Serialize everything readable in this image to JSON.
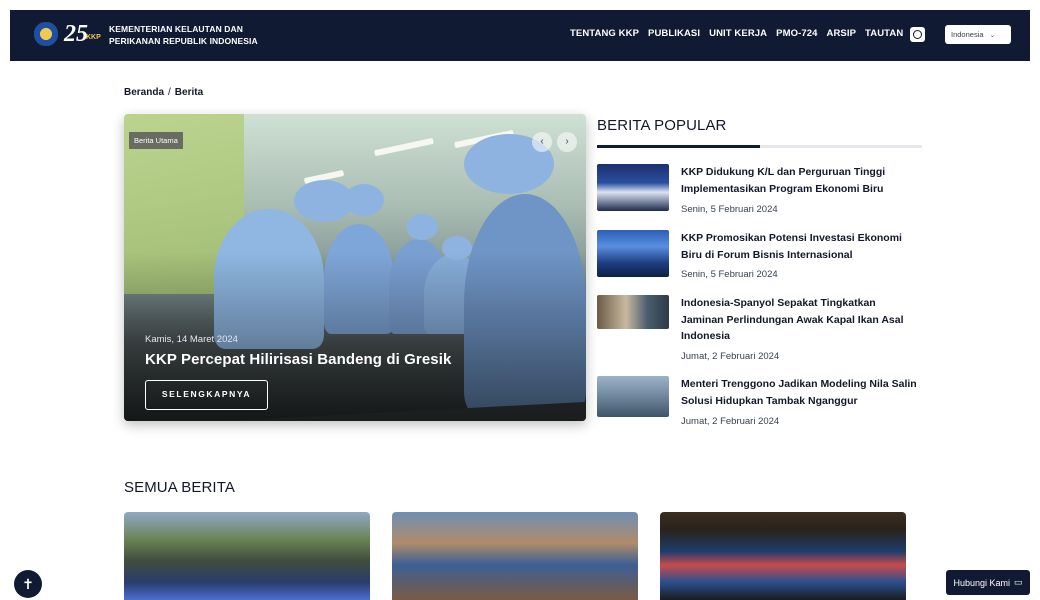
{
  "header": {
    "org_name_line1": "KEMENTERIAN KELAUTAN DAN",
    "org_name_line2": "PERIKANAN REPUBLIK INDONESIA",
    "logo_25": "25",
    "logo_kkp": "KKP",
    "nav": [
      "TENTANG KKP",
      "PUBLIKASI",
      "UNIT KERJA",
      "PMO-724",
      "ARSIP",
      "TAUTAN"
    ],
    "language": "Indonesia",
    "colors": {
      "navbar": "#111a33",
      "accent": "#f2c94c"
    }
  },
  "breadcrumb": {
    "home": "Beranda",
    "separator": "/",
    "current": "Berita"
  },
  "hero": {
    "tag": "Berita Utama",
    "date": "Kamis, 14 Maret 2024",
    "title": "KKP Percepat Hilirisasi Bandeng di Gresik",
    "button": "SELENGKAPNYA",
    "prev_icon": "‹",
    "next_icon": "›"
  },
  "popular": {
    "heading": "BERITA POPULAR",
    "items": [
      {
        "title": "KKP Didukung K/L dan Perguruan Tinggi Implementasikan Program Ekonomi Biru",
        "date": "Senin, 5 Februari 2024"
      },
      {
        "title": "KKP Promosikan Potensi Investasi Ekonomi Biru di Forum Bisnis Internasional",
        "date": "Senin, 5 Februari 2024"
      },
      {
        "title": "Indonesia-Spanyol Sepakat Tingkatkan Jaminan Perlindungan Awak Kapal Ikan Asal Indonesia",
        "date": "Jumat, 2 Februari 2024"
      },
      {
        "title": "Menteri Trenggono Jadikan Modeling Nila Salin Solusi Hidupkan Tambak Nganggur",
        "date": "Jumat, 2 Februari 2024"
      }
    ]
  },
  "all_news": {
    "heading": "SEMUA BERITA"
  },
  "floating": {
    "contact": "Hubungi Kami",
    "accessibility_icon": "accessibility-icon"
  }
}
